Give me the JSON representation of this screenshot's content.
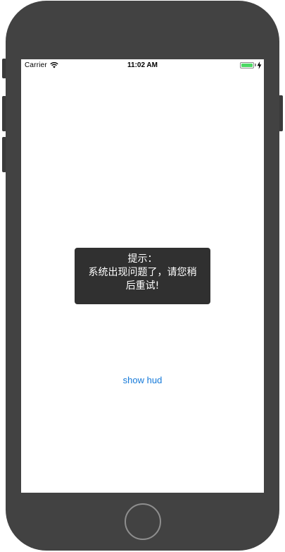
{
  "status_bar": {
    "carrier": "Carrier",
    "time": "11:02 AM",
    "wifi_icon": "wifi-icon",
    "battery_icon": "battery-icon",
    "charging_icon": "lightning-bolt-icon",
    "battery_color": "#4cd964"
  },
  "hud": {
    "title": "提示：",
    "message_line1": "系统出现问题了，请您稍",
    "message_line2": "后重试!",
    "background": "#303030"
  },
  "main": {
    "show_hud_label": "show hud",
    "link_color": "#1479d9"
  },
  "device": {
    "frame_color": "#424242",
    "home_button_icon": "home-button-icon"
  }
}
